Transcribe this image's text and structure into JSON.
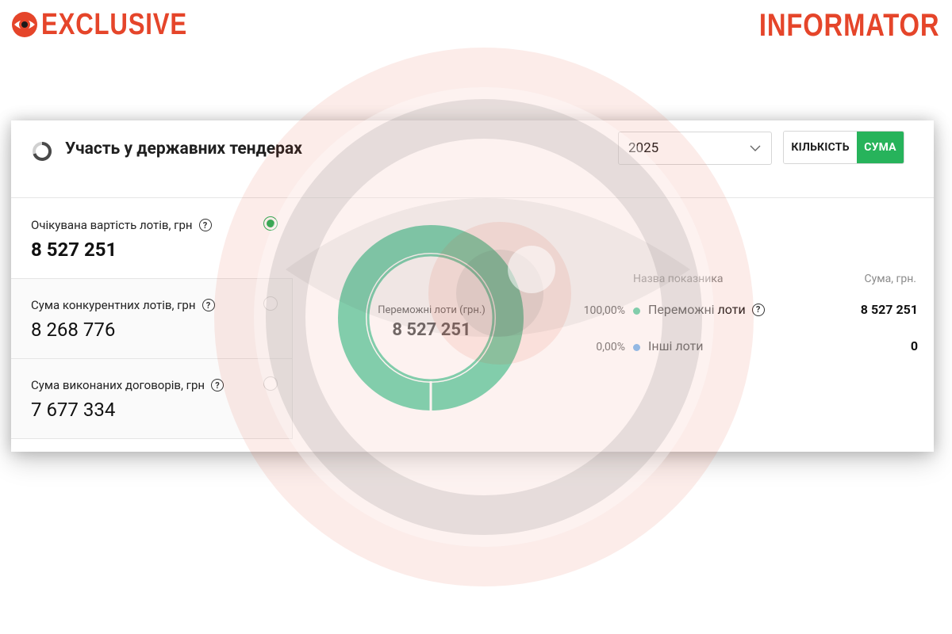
{
  "brand": {
    "left": "EXCLUSIVE",
    "right": "INFORMATOR",
    "color": "#e5452a"
  },
  "widget": {
    "title": "Участь у державних тендерах",
    "year_select": {
      "value": "2025"
    },
    "toggle": {
      "count_label": "КІЛЬКІСТЬ",
      "sum_label": "СУМА",
      "active": "СУМА"
    },
    "accent_color": "#27b35b"
  },
  "metrics": [
    {
      "label": "Очікувана вартість лотів, грн",
      "value": "8 527 251",
      "selected": true
    },
    {
      "label": "Сума конкурентних лотів, грн",
      "value": "8 268 776",
      "selected": false
    },
    {
      "label": "Сума виконаних договорів, грн",
      "value": "7 677 334",
      "selected": false
    }
  ],
  "donut": {
    "center_label": "Переможні лоти (грн.)",
    "center_value": "8 527 251"
  },
  "legend": {
    "col_name": "Назва показника",
    "col_sum": "Сума, грн.",
    "rows": [
      {
        "pct": "100,00%",
        "name": "Переможні лоти",
        "value": "8 527 251",
        "color": "#2ec08a",
        "help": true
      },
      {
        "pct": "0,00%",
        "name": "Інші лоти",
        "value": "0",
        "color": "#4a9be8",
        "help": false
      }
    ]
  },
  "chart_data": {
    "type": "pie",
    "categories": [
      "Переможні лоти",
      "Інші лоти"
    ],
    "values": [
      8527251,
      0
    ],
    "percentages": [
      100.0,
      0.0
    ],
    "title": "",
    "center_label": "Переможні лоти (грн.)",
    "center_value": "8 527 251"
  }
}
